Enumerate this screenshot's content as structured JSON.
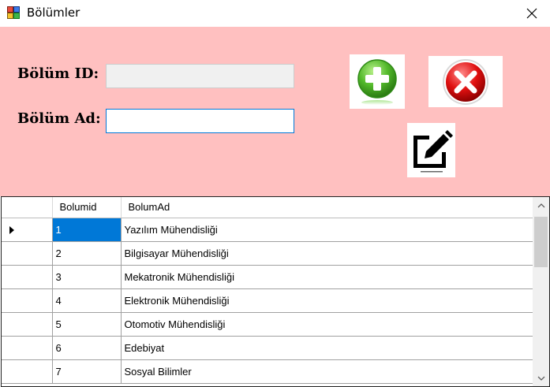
{
  "window": {
    "title": "Bölümler",
    "app_icon": "windows-form-icon",
    "close_icon": "close-icon"
  },
  "form": {
    "id_label": "Bölüm ID:",
    "id_value": "",
    "ad_label": "Bölüm Ad:",
    "ad_value": "",
    "background": "#ffc0c0",
    "buttons": {
      "add_icon": "green-plus-icon",
      "delete_icon": "red-x-icon",
      "edit_icon": "edit-pencil-icon"
    }
  },
  "grid": {
    "columns": [
      "Bolumid",
      "BolumAd"
    ],
    "selected_row": 0,
    "selection_color": "#0078d7",
    "rows": [
      {
        "id": "1",
        "ad": "Yazılım Mühendisliği"
      },
      {
        "id": "2",
        "ad": "Bilgisayar Mühendisliği"
      },
      {
        "id": "3",
        "ad": "Mekatronik Mühendisliği"
      },
      {
        "id": "4",
        "ad": "Elektronik Mühendisliği"
      },
      {
        "id": "5",
        "ad": "Otomotiv Mühendisliği"
      },
      {
        "id": "6",
        "ad": "Edebiyat"
      },
      {
        "id": "7",
        "ad": "Sosyal Bilimler"
      }
    ]
  }
}
